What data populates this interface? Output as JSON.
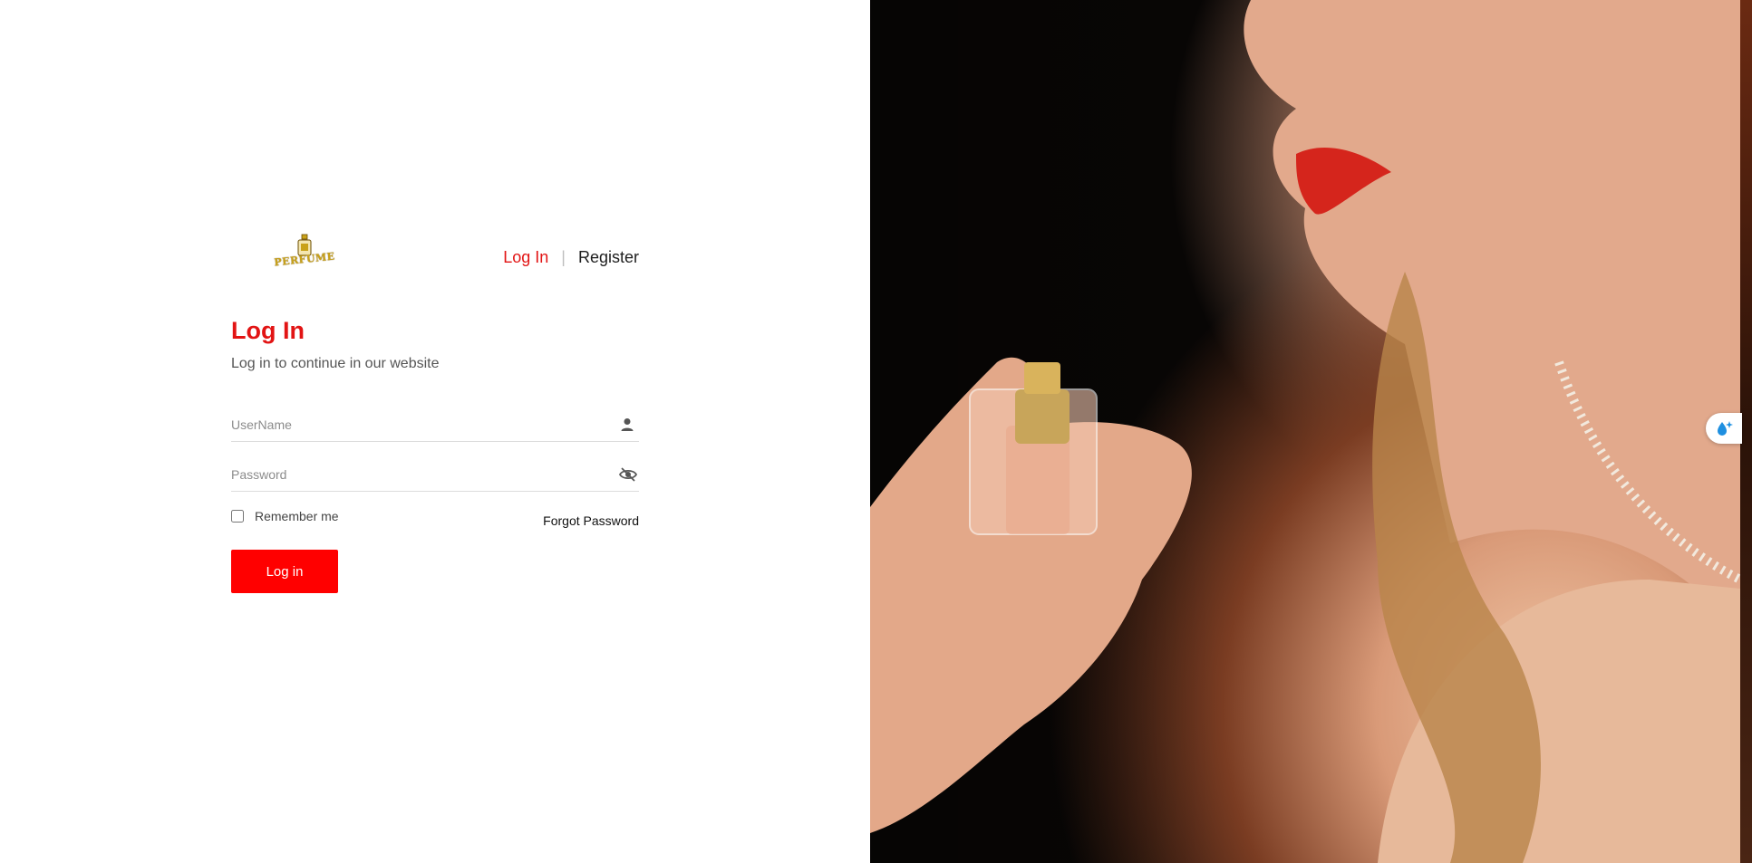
{
  "brand": {
    "logo_text": "PERFUME"
  },
  "nav": {
    "login_label": "Log In",
    "separator": "|",
    "register_label": "Register"
  },
  "form": {
    "title": "Log In",
    "subtitle": "Log in to continue in our website",
    "username_placeholder": "UserName",
    "password_placeholder": "Password",
    "remember_label": "Remember me",
    "forgot_label": "Forgot Password",
    "submit_label": "Log in"
  },
  "colors": {
    "accent": "#e21414",
    "button": "#ff0000"
  },
  "icons": {
    "username": "user-icon",
    "password": "eye-slash-icon",
    "floating": "water-drop-sparkle-icon"
  }
}
